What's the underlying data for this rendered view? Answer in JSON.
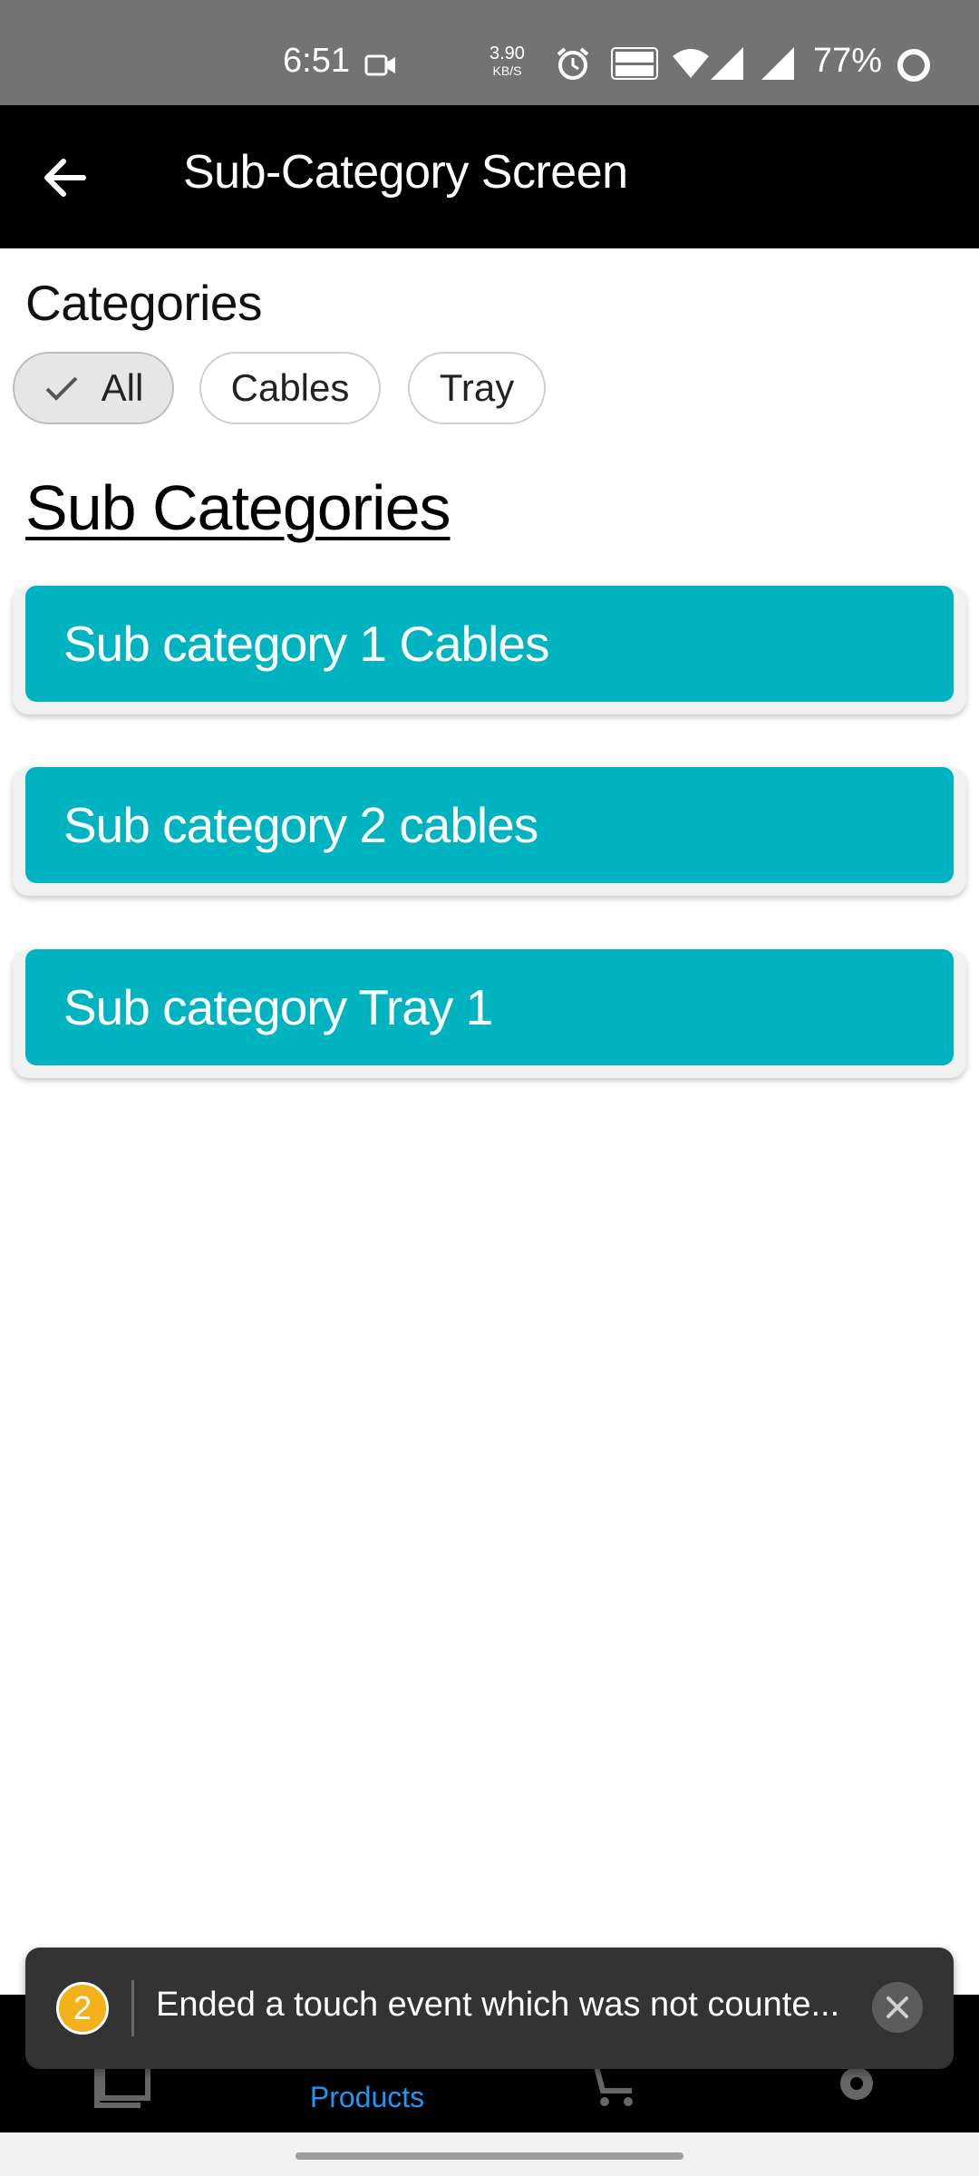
{
  "status_bar": {
    "time": "6:51",
    "net_speed": "3.90",
    "net_unit": "KB/S",
    "battery": "77%",
    "icons": [
      "video-camera-icon",
      "alarm-icon",
      "volte-icon",
      "wifi-icon",
      "signal-icon",
      "signal-icon",
      "battery-ring-icon"
    ]
  },
  "app_bar": {
    "title": "Sub-Category Screen"
  },
  "categories": {
    "heading": "Categories",
    "chips": [
      {
        "label": "All",
        "selected": true
      },
      {
        "label": "Cables",
        "selected": false
      },
      {
        "label": "Tray",
        "selected": false
      }
    ]
  },
  "sub_categories": {
    "heading": "Sub Categories",
    "items": [
      "Sub category 1 Cables",
      "Sub category 2 cables",
      "Sub category Tray 1"
    ]
  },
  "toast": {
    "badge": "2",
    "message": "Ended a touch event which was not counte..."
  },
  "bottom_nav": {
    "items": [
      {
        "icon": "library-add-icon",
        "label": ""
      },
      {
        "icon": "products-icon",
        "label": "Products",
        "active": true
      },
      {
        "icon": "cart-icon",
        "label": ""
      },
      {
        "icon": "settings-icon",
        "label": ""
      }
    ]
  },
  "colors": {
    "status_bar": "#737373",
    "app_bar": "#000000",
    "card": "#00b3c1",
    "active_nav": "#2196f3",
    "toast": "#333333",
    "badge": "#f3b21a"
  }
}
